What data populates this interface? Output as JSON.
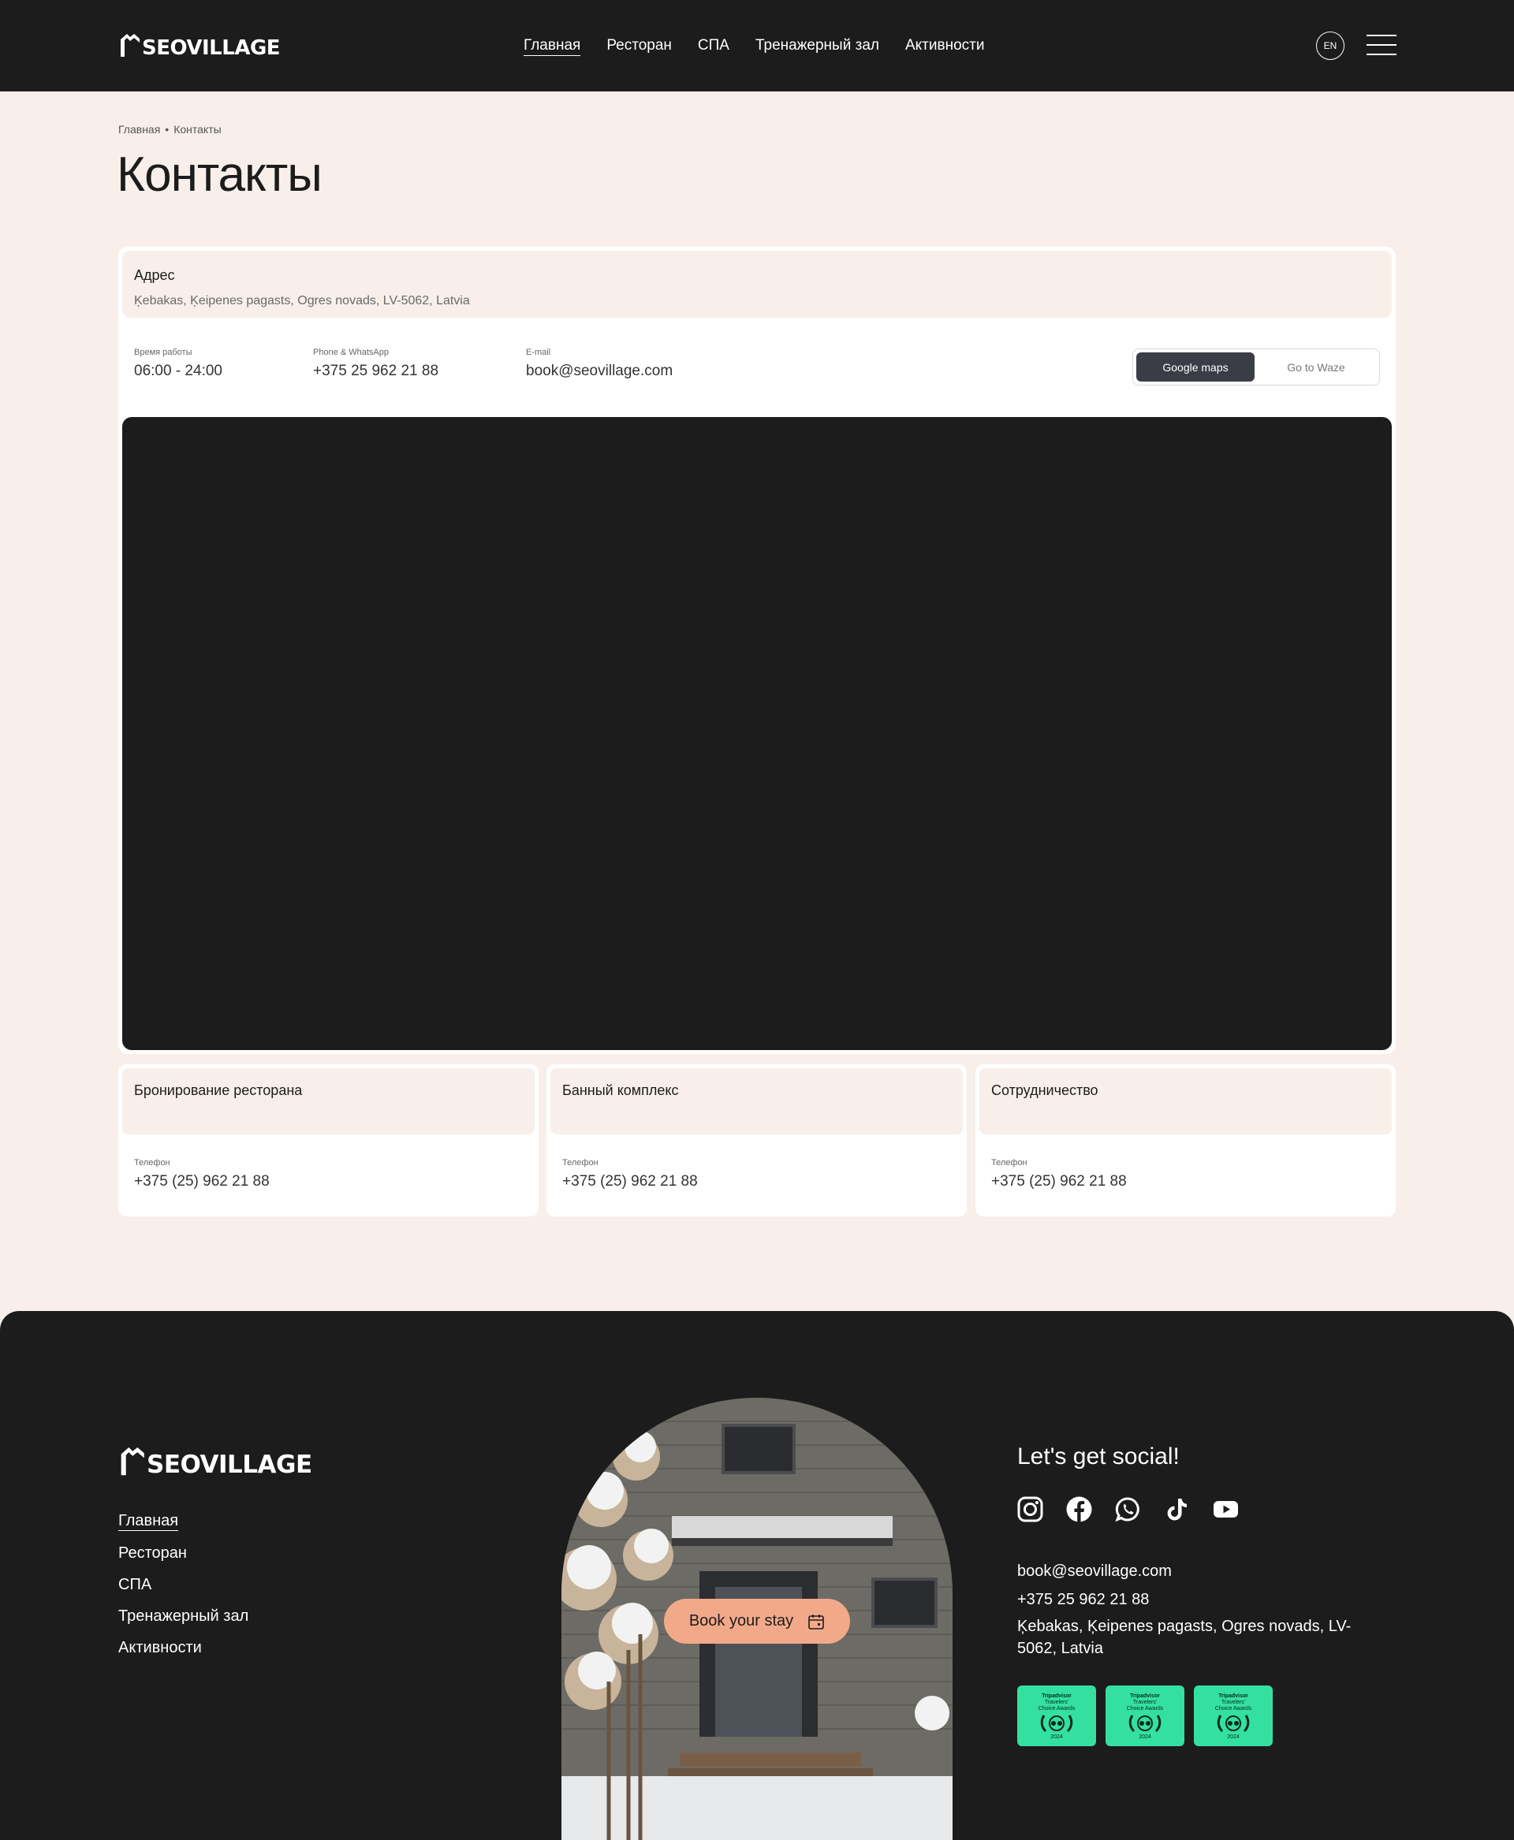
{
  "header": {
    "logo_text": "SEOVILLAGE",
    "nav": [
      "Главная",
      "Ресторан",
      "СПА",
      "Тренажерный зал",
      "Активности"
    ],
    "active_nav": "Главная",
    "lang": "EN"
  },
  "breadcrumb": {
    "home": "Главная",
    "separator": "•",
    "current": "Контакты"
  },
  "page_title": "Контакты",
  "contacts": {
    "address_label": "Адрес",
    "address_value": "Ķebakas, Ķeipenes pagasts, Ogres novads, LV-5062, Latvia",
    "hours_label": "Время работы",
    "hours_value": "06:00 - 24:00",
    "phone_label": "Phone & WhatsApp",
    "phone_value": "+375 25 962 21 88",
    "email_label": "E-mail",
    "email_value": "book@seovillage.com",
    "map_buttons": [
      "Google maps",
      "Go to Waze"
    ],
    "active_map": "Google maps"
  },
  "departments": [
    {
      "title": "Бронирование ресторана",
      "phone_label": "Телефон",
      "phone": "+375 (25) 962 21 88"
    },
    {
      "title": "Банный комплекс",
      "phone_label": "Телефон",
      "phone": "+375 (25) 962 21 88"
    },
    {
      "title": "Сотрудничество",
      "phone_label": "Телефон",
      "phone": "+375 (25) 962 21 88"
    }
  ],
  "footer": {
    "logo_text": "SEOVILLAGE",
    "nav": [
      "Главная",
      "Ресторан",
      "СПА",
      "Тренажерный зал",
      "Активности"
    ],
    "book_label": "Book your stay",
    "social_title": "Let's get social!",
    "social_icons": [
      "instagram-icon",
      "facebook-icon",
      "whatsapp-icon",
      "tiktok-icon",
      "youtube-icon"
    ],
    "email": "book@seovillage.com",
    "phone": "+375 25 962 21 88",
    "address": "Ķebakas, Ķeipenes pagasts, Ogres novads, LV-5062, Latvia",
    "badge": {
      "title": "Tripadvisor",
      "line1": "Travelers'",
      "line2": "Choice Awards",
      "year": "2024"
    }
  },
  "colors": {
    "dark": "#1c1c1c",
    "page_bg": "#f8efea",
    "accent_button": "#f2a98a",
    "tripadvisor_green": "#34e0a1",
    "toggle_active": "#3b3d46"
  }
}
